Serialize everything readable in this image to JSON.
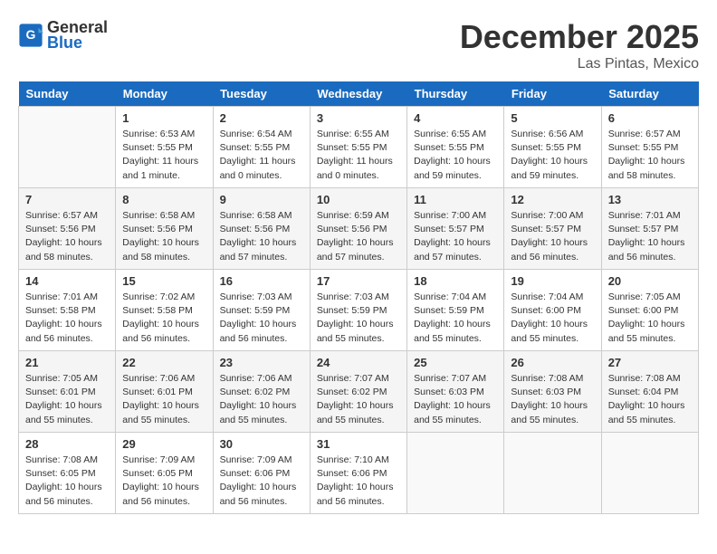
{
  "header": {
    "logo_line1": "General",
    "logo_line2": "Blue",
    "month": "December 2025",
    "location": "Las Pintas, Mexico"
  },
  "weekdays": [
    "Sunday",
    "Monday",
    "Tuesday",
    "Wednesday",
    "Thursday",
    "Friday",
    "Saturday"
  ],
  "weeks": [
    [
      {
        "day": "",
        "info": ""
      },
      {
        "day": "1",
        "info": "Sunrise: 6:53 AM\nSunset: 5:55 PM\nDaylight: 11 hours\nand 1 minute."
      },
      {
        "day": "2",
        "info": "Sunrise: 6:54 AM\nSunset: 5:55 PM\nDaylight: 11 hours\nand 0 minutes."
      },
      {
        "day": "3",
        "info": "Sunrise: 6:55 AM\nSunset: 5:55 PM\nDaylight: 11 hours\nand 0 minutes."
      },
      {
        "day": "4",
        "info": "Sunrise: 6:55 AM\nSunset: 5:55 PM\nDaylight: 10 hours\nand 59 minutes."
      },
      {
        "day": "5",
        "info": "Sunrise: 6:56 AM\nSunset: 5:55 PM\nDaylight: 10 hours\nand 59 minutes."
      },
      {
        "day": "6",
        "info": "Sunrise: 6:57 AM\nSunset: 5:55 PM\nDaylight: 10 hours\nand 58 minutes."
      }
    ],
    [
      {
        "day": "7",
        "info": "Sunrise: 6:57 AM\nSunset: 5:56 PM\nDaylight: 10 hours\nand 58 minutes."
      },
      {
        "day": "8",
        "info": "Sunrise: 6:58 AM\nSunset: 5:56 PM\nDaylight: 10 hours\nand 58 minutes."
      },
      {
        "day": "9",
        "info": "Sunrise: 6:58 AM\nSunset: 5:56 PM\nDaylight: 10 hours\nand 57 minutes."
      },
      {
        "day": "10",
        "info": "Sunrise: 6:59 AM\nSunset: 5:56 PM\nDaylight: 10 hours\nand 57 minutes."
      },
      {
        "day": "11",
        "info": "Sunrise: 7:00 AM\nSunset: 5:57 PM\nDaylight: 10 hours\nand 57 minutes."
      },
      {
        "day": "12",
        "info": "Sunrise: 7:00 AM\nSunset: 5:57 PM\nDaylight: 10 hours\nand 56 minutes."
      },
      {
        "day": "13",
        "info": "Sunrise: 7:01 AM\nSunset: 5:57 PM\nDaylight: 10 hours\nand 56 minutes."
      }
    ],
    [
      {
        "day": "14",
        "info": "Sunrise: 7:01 AM\nSunset: 5:58 PM\nDaylight: 10 hours\nand 56 minutes."
      },
      {
        "day": "15",
        "info": "Sunrise: 7:02 AM\nSunset: 5:58 PM\nDaylight: 10 hours\nand 56 minutes."
      },
      {
        "day": "16",
        "info": "Sunrise: 7:03 AM\nSunset: 5:59 PM\nDaylight: 10 hours\nand 56 minutes."
      },
      {
        "day": "17",
        "info": "Sunrise: 7:03 AM\nSunset: 5:59 PM\nDaylight: 10 hours\nand 55 minutes."
      },
      {
        "day": "18",
        "info": "Sunrise: 7:04 AM\nSunset: 5:59 PM\nDaylight: 10 hours\nand 55 minutes."
      },
      {
        "day": "19",
        "info": "Sunrise: 7:04 AM\nSunset: 6:00 PM\nDaylight: 10 hours\nand 55 minutes."
      },
      {
        "day": "20",
        "info": "Sunrise: 7:05 AM\nSunset: 6:00 PM\nDaylight: 10 hours\nand 55 minutes."
      }
    ],
    [
      {
        "day": "21",
        "info": "Sunrise: 7:05 AM\nSunset: 6:01 PM\nDaylight: 10 hours\nand 55 minutes."
      },
      {
        "day": "22",
        "info": "Sunrise: 7:06 AM\nSunset: 6:01 PM\nDaylight: 10 hours\nand 55 minutes."
      },
      {
        "day": "23",
        "info": "Sunrise: 7:06 AM\nSunset: 6:02 PM\nDaylight: 10 hours\nand 55 minutes."
      },
      {
        "day": "24",
        "info": "Sunrise: 7:07 AM\nSunset: 6:02 PM\nDaylight: 10 hours\nand 55 minutes."
      },
      {
        "day": "25",
        "info": "Sunrise: 7:07 AM\nSunset: 6:03 PM\nDaylight: 10 hours\nand 55 minutes."
      },
      {
        "day": "26",
        "info": "Sunrise: 7:08 AM\nSunset: 6:03 PM\nDaylight: 10 hours\nand 55 minutes."
      },
      {
        "day": "27",
        "info": "Sunrise: 7:08 AM\nSunset: 6:04 PM\nDaylight: 10 hours\nand 55 minutes."
      }
    ],
    [
      {
        "day": "28",
        "info": "Sunrise: 7:08 AM\nSunset: 6:05 PM\nDaylight: 10 hours\nand 56 minutes."
      },
      {
        "day": "29",
        "info": "Sunrise: 7:09 AM\nSunset: 6:05 PM\nDaylight: 10 hours\nand 56 minutes."
      },
      {
        "day": "30",
        "info": "Sunrise: 7:09 AM\nSunset: 6:06 PM\nDaylight: 10 hours\nand 56 minutes."
      },
      {
        "day": "31",
        "info": "Sunrise: 7:10 AM\nSunset: 6:06 PM\nDaylight: 10 hours\nand 56 minutes."
      },
      {
        "day": "",
        "info": ""
      },
      {
        "day": "",
        "info": ""
      },
      {
        "day": "",
        "info": ""
      }
    ]
  ]
}
